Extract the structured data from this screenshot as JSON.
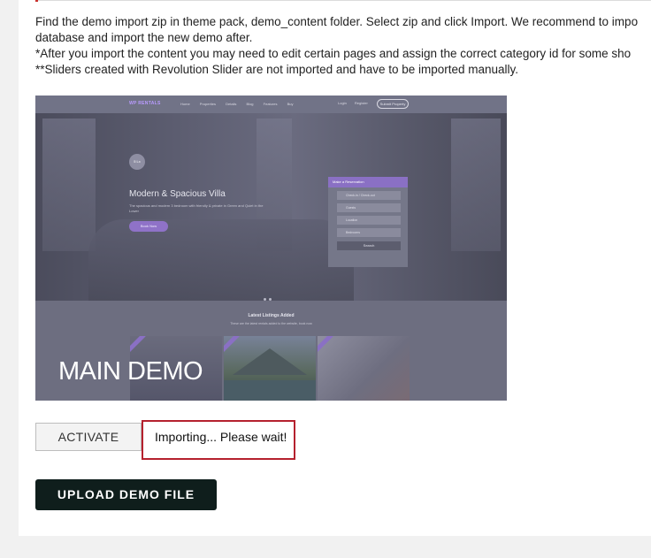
{
  "instructions": {
    "line1": "Find the demo import zip in theme pack, demo_content folder. Select zip and click Import. We recommend to impo",
    "line2": "database and import the new demo after.",
    "line3": "*After you import the content you may need to edit certain pages and assign the correct category id for some sho",
    "line4": "**Sliders created with Revolution Slider are not imported and have to be imported manually."
  },
  "preview": {
    "logo": "WP RENTALS",
    "nav_links": [
      "Home",
      "Properties",
      "Details",
      "Blog",
      "Features",
      "Buy"
    ],
    "auth": [
      "Login",
      "Register"
    ],
    "submit": "Submit Property",
    "badge": "5 Lx",
    "hero_title": "Modern & Spacious Villa",
    "hero_subtitle": "The spacious and modern 3 bedroom with friendly & private in Green and Quiet in the Lower",
    "hero_button": "Book Now",
    "form_title": "Make a Reservation",
    "form_fields": [
      "Check-in / Check-out",
      "Guests",
      "Location",
      "Bedrooms"
    ],
    "form_search": "Search",
    "listings_title": "Latest Listings Added",
    "listings_subtitle": "These are the latest rentals added to the website, book now",
    "demo_label": "MAIN DEMO"
  },
  "actions": {
    "activate_label": "ACTIVATE",
    "importing_status": "Importing... Please wait!",
    "upload_label": "UPLOAD DEMO FILE"
  },
  "colors": {
    "highlight_border": "#b5212e",
    "upload_button_bg": "#0f1e1c",
    "preview_overlay": "#6b6c7e"
  }
}
